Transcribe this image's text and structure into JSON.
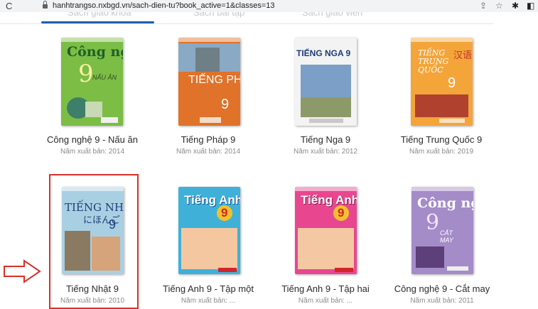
{
  "browser": {
    "reload_icon": "reload-icon",
    "reload_glyph": "C",
    "url": "hanhtrangso.nxbgd.vn/sach-dien-tu?book_active=1&classes=13",
    "toolbar_icons": [
      "share-icon",
      "star-icon",
      "extensions-icon",
      "sidebar-icon"
    ]
  },
  "tabs": [
    {
      "label": "Sách giáo khoa"
    },
    {
      "label": "Sách bài tập"
    },
    {
      "label": "Sách giáo viên"
    }
  ],
  "colors": {
    "accent": "#1f5fa8",
    "highlight": "#d9302b"
  },
  "books": [
    {
      "title": "Công nghệ 9 - Nấu ăn",
      "year_text": "Năm xuất bản: 2014",
      "cover": {
        "title": "Công nghệ",
        "number": "9",
        "subtitle": "NẤU ĂN",
        "bg": "#7cbd45"
      }
    },
    {
      "title": "Tiếng Pháp 9",
      "year_text": "Năm xuất bản: 2014",
      "cover": {
        "title": "TIẾNG PHÁP",
        "number": "9",
        "bg": "#e0722a"
      }
    },
    {
      "title": "Tiếng Nga 9",
      "year_text": "Năm xuất bản: 2012",
      "cover": {
        "title": "TIẾNG NGA 9",
        "bg": "#f3f3f3"
      }
    },
    {
      "title": "Tiếng Trung Quốc 9",
      "year_text": "Năm xuất bản: 2019",
      "cover": {
        "title": "TIẾNG TRUNG QUỐC",
        "number": "9",
        "bg": "#f3a53a"
      }
    },
    {
      "title": "Tiếng Nhật 9",
      "year_text": "Năm xuất bản: 2010",
      "cover": {
        "title": "TIẾNG NHẬT",
        "number": "9",
        "bg": "#a9cfe2"
      }
    },
    {
      "title": "Tiếng Anh 9 - Tập một",
      "year_text": "Năm xuất bản: ...",
      "cover": {
        "title": "Tiếng Anh",
        "number": "9",
        "bg": "#3fb1d9"
      }
    },
    {
      "title": "Tiếng Anh 9 - Tập hai",
      "year_text": "Năm xuất bản: ...",
      "cover": {
        "title": "Tiếng Anh",
        "number": "9",
        "bg": "#e8478f"
      }
    },
    {
      "title": "Công nghệ 9 - Cắt may",
      "year_text": "Năm xuất bản: 2011",
      "cover": {
        "title": "Công nghệ",
        "number": "9",
        "subtitle": "CẮT MAY",
        "bg": "#a48cc8"
      }
    }
  ],
  "annotation": {
    "arrow_icon": "right-arrow-icon",
    "highlighted_book": "Tiếng Nhật 9"
  }
}
